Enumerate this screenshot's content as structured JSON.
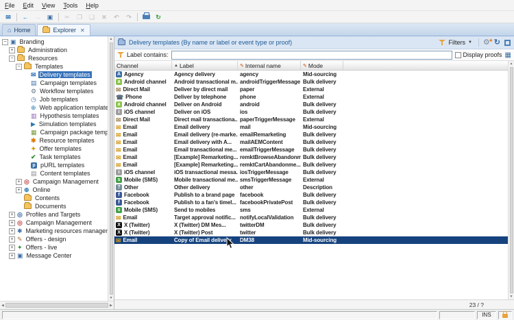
{
  "window": {
    "menubar": [
      "File",
      "Edit",
      "View",
      "Tools",
      "Help"
    ],
    "tabs": [
      {
        "id": "home",
        "label": "Home",
        "icon": "home-icon",
        "active": false,
        "closable": false
      },
      {
        "id": "explorer",
        "label": "Explorer",
        "icon": "explorer-folder-icon",
        "active": true,
        "closable": true
      }
    ],
    "statusbar": {
      "ins_label": "INS",
      "lock_icon": "lock-icon"
    }
  },
  "toolbar": [
    {
      "name": "new-message-button",
      "icon": "envelope-icon"
    },
    {
      "separator": true
    },
    {
      "name": "back-button",
      "icon": "arrow-left-icon"
    },
    {
      "name": "forward-button",
      "icon": "arrow-right-icon",
      "disabled": true
    },
    {
      "name": "save-button",
      "icon": "save-icon"
    },
    {
      "separator": true
    },
    {
      "name": "cut-button",
      "icon": "cut-icon",
      "disabled": true
    },
    {
      "name": "copy-button",
      "icon": "copy-icon",
      "disabled": true
    },
    {
      "name": "paste-button",
      "icon": "paste-icon",
      "disabled": true
    },
    {
      "name": "delete-button",
      "icon": "delete-icon",
      "disabled": true
    },
    {
      "name": "undo-button",
      "icon": "undo-icon",
      "disabled": true
    },
    {
      "name": "redo-button",
      "icon": "redo-icon",
      "disabled": true
    },
    {
      "separator": true
    },
    {
      "name": "print-button",
      "icon": "print-icon"
    },
    {
      "name": "refresh-button",
      "icon": "refresh-icon"
    }
  ],
  "tree": {
    "items": [
      {
        "label": "Branding",
        "level": 0,
        "expander": "minus",
        "icon": "branding-icon"
      },
      {
        "label": "Administration",
        "level": 1,
        "expander": "plus",
        "icon": "folder-icon"
      },
      {
        "label": "Resources",
        "level": 1,
        "expander": "minus",
        "icon": "folder-open-icon"
      },
      {
        "label": "Templates",
        "level": 2,
        "expander": "minus",
        "icon": "folder-open-icon"
      },
      {
        "label": "Delivery templates",
        "level": 3,
        "icon": "delivery-template-icon",
        "selected": true
      },
      {
        "label": "Campaign templates",
        "level": 3,
        "icon": "campaign-template-icon"
      },
      {
        "label": "Workflow templates",
        "level": 3,
        "icon": "workflow-template-icon"
      },
      {
        "label": "Job templates",
        "level": 3,
        "icon": "job-template-icon"
      },
      {
        "label": "Web application templates",
        "level": 3,
        "icon": "web-app-template-icon"
      },
      {
        "label": "Hypothesis templates",
        "level": 3,
        "icon": "hypothesis-template-icon"
      },
      {
        "label": "Simulation templates",
        "level": 3,
        "icon": "simulation-template-icon"
      },
      {
        "label": "Campaign package templates",
        "level": 3,
        "icon": "package-template-icon"
      },
      {
        "label": "Resource templates",
        "level": 3,
        "icon": "resource-template-icon"
      },
      {
        "label": "Offer templates",
        "level": 3,
        "icon": "offer-template-icon"
      },
      {
        "label": "Task templates",
        "level": 3,
        "icon": "task-template-icon"
      },
      {
        "label": "pURL templates",
        "level": 3,
        "icon": "purl-template-icon"
      },
      {
        "label": "Content templates",
        "level": 3,
        "icon": "content-template-icon"
      },
      {
        "label": "Campaign Management",
        "level": 2,
        "expander": "plus",
        "icon": "campaign-mgmt-icon"
      },
      {
        "label": "Online",
        "level": 2,
        "expander": "plus",
        "icon": "online-icon"
      },
      {
        "label": "Contents",
        "level": 2,
        "icon": "folder-icon"
      },
      {
        "label": "Documents",
        "level": 2,
        "icon": "folder-icon"
      },
      {
        "label": "Profiles and Targets",
        "level": 1,
        "expander": "plus",
        "icon": "profiles-icon"
      },
      {
        "label": "Campaign Management",
        "level": 1,
        "expander": "plus",
        "icon": "campaign-mgmt-icon"
      },
      {
        "label": "Marketing resources management",
        "level": 1,
        "expander": "plus",
        "icon": "mrm-icon"
      },
      {
        "label": "Offers - design",
        "level": 1,
        "expander": "plus",
        "icon": "offers-design-icon"
      },
      {
        "label": "Offers - live",
        "level": 1,
        "expander": "plus",
        "icon": "offers-live-icon"
      },
      {
        "label": "Message Center",
        "level": 1,
        "expander": "plus",
        "icon": "message-center-icon"
      }
    ]
  },
  "main": {
    "header": {
      "title": "Delivery templates (By name or label or event type or proof)",
      "filters_button_label": "Filters"
    },
    "filter_row": {
      "label": "Label contains:",
      "input_value": "",
      "display_proofs_label": "Display proofs",
      "proofs_checked": false
    },
    "table": {
      "columns": [
        {
          "label": "Channel"
        },
        {
          "label": "Label",
          "sort": "asc"
        },
        {
          "label": "Internal name",
          "edit_icon": true
        },
        {
          "label": "Mode",
          "edit_icon": true
        }
      ],
      "rows": [
        {
          "icon": "agency-channel-icon",
          "channel": "Agency",
          "label": "Agency delivery",
          "internal": "agency",
          "mode": "Mid-sourcing"
        },
        {
          "icon": "android-channel-icon",
          "channel": "Android channel",
          "label": "Android transactional m...",
          "internal": "androidTriggerMessage",
          "mode": "Bulk delivery"
        },
        {
          "icon": "direct-mail-channel-icon",
          "channel": "Direct Mail",
          "label": "Deliver by direct mail",
          "internal": "paper",
          "mode": "External"
        },
        {
          "icon": "phone-channel-icon",
          "channel": "Phone",
          "label": "Deliver by telephone",
          "internal": "phone",
          "mode": "External"
        },
        {
          "icon": "android-channel-icon",
          "channel": "Android channel",
          "label": "Deliver on Android",
          "internal": "android",
          "mode": "Bulk delivery"
        },
        {
          "icon": "ios-channel-icon",
          "channel": "iOS channel",
          "label": "Deliver on iOS",
          "internal": "ios",
          "mode": "Bulk delivery"
        },
        {
          "icon": "direct-mail-channel-icon",
          "channel": "Direct Mail",
          "label": "Direct mail transactiona...",
          "internal": "paperTriggerMessage",
          "mode": "External"
        },
        {
          "icon": "email-channel-icon",
          "channel": "Email",
          "label": "Email delivery",
          "internal": "mail",
          "mode": "Mid-sourcing"
        },
        {
          "icon": "email-channel-icon",
          "channel": "Email",
          "label": "Email delivery (re-marke...",
          "internal": "emailRemarketing",
          "mode": "Bulk delivery"
        },
        {
          "icon": "email-channel-icon",
          "channel": "Email",
          "label": "Email delivery with A...",
          "internal": "mailAEMContent",
          "mode": "Bulk delivery"
        },
        {
          "icon": "email-channel-icon",
          "channel": "Email",
          "label": "Email transactional me...",
          "internal": "emailTriggerMessage",
          "mode": "Bulk delivery"
        },
        {
          "icon": "email-channel-icon",
          "channel": "Email",
          "label": "[Example] Remarketing...",
          "internal": "remktBrowseAbandonm...",
          "mode": "Bulk delivery"
        },
        {
          "icon": "email-channel-icon",
          "channel": "Email",
          "label": "[Example] Remarketing...",
          "internal": "remktCartAbandonme...",
          "mode": "Bulk delivery"
        },
        {
          "icon": "ios-channel-icon",
          "channel": "iOS channel",
          "label": "iOS transactional messa...",
          "internal": "iosTriggerMessage",
          "mode": "Bulk delivery"
        },
        {
          "icon": "sms-channel-icon",
          "channel": "Mobile (SMS)",
          "label": "Mobile transactional me...",
          "internal": "smsTriggerMessage",
          "mode": "External"
        },
        {
          "icon": "other-channel-icon",
          "channel": "Other",
          "label": "Other delivery",
          "internal": "other",
          "mode": "Description"
        },
        {
          "icon": "facebook-channel-icon",
          "channel": "Facebook",
          "label": "Publish to a brand page",
          "internal": "facebook",
          "mode": "Bulk delivery"
        },
        {
          "icon": "facebook-channel-icon",
          "channel": "Facebook",
          "label": "Publish to a fan's timel...",
          "internal": "facebookPrivatePost",
          "mode": "Bulk delivery"
        },
        {
          "icon": "sms-channel-icon",
          "channel": "Mobile (SMS)",
          "label": "Send to mobiles",
          "internal": "sms",
          "mode": "External"
        },
        {
          "icon": "email-channel-icon",
          "channel": "Email",
          "label": "Target approval notific...",
          "internal": "notifyLocalValidation",
          "mode": "Bulk delivery"
        },
        {
          "icon": "twitter-channel-icon",
          "channel": "X (Twitter)",
          "label": "X (Twitter) DM Mes...",
          "internal": "twitterDM",
          "mode": "Bulk delivery"
        },
        {
          "icon": "twitter-channel-icon",
          "channel": "X (Twitter)",
          "label": "X (Twitter) Post",
          "internal": "twitter",
          "mode": "Bulk delivery"
        },
        {
          "icon": "email-channel-icon",
          "channel": "Email",
          "label": "Copy of Email delivery",
          "internal": "DM38",
          "mode": "Mid-sourcing",
          "selected": true
        }
      ]
    },
    "count_label": "23 / ?"
  }
}
